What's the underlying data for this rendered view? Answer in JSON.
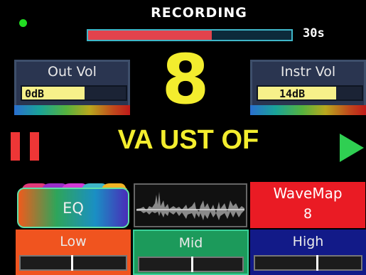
{
  "recording": {
    "title": "RECORDING",
    "time": "30s",
    "progress": 0.61,
    "indicator_color": "#22dd22"
  },
  "out_vol": {
    "label": "Out Vol",
    "value": "0dB",
    "level": 0.6
  },
  "instr_vol": {
    "label": "Instr Vol",
    "value": "14dB",
    "level": 0.75
  },
  "preset_number": "8",
  "preset_name": "VA UST OF",
  "transport": {
    "pause_icon": "pause-icon",
    "play_icon": "play-icon"
  },
  "eq": {
    "label": "EQ"
  },
  "wavemap": {
    "label": "WaveMap",
    "value": "8"
  },
  "bands": [
    {
      "label": "Low",
      "level": 0.48,
      "color": "#f0541f"
    },
    {
      "label": "Mid",
      "level": 0.5,
      "color": "#1c9a5b"
    },
    {
      "label": "High",
      "level": 0.58,
      "color": "#121a88"
    }
  ],
  "colors": {
    "accent_yellow": "#f3ed2e",
    "record_red": "#e2434c",
    "play_green": "#2fcf52"
  }
}
